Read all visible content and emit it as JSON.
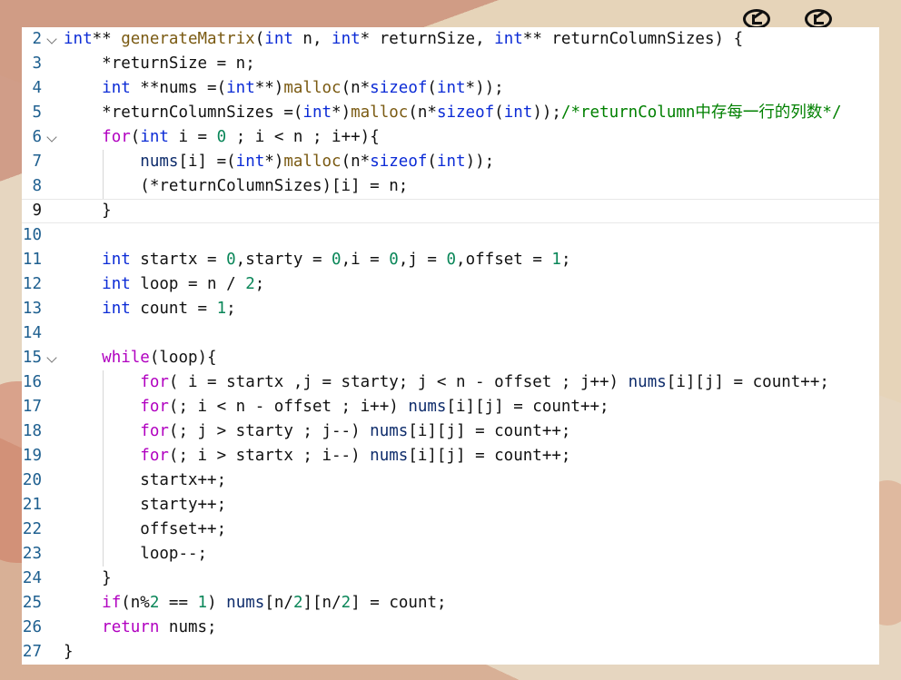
{
  "colors": {
    "editor_bg": "#ffffff",
    "line_number": "#1e5f8f",
    "keyword": "#0b2bd6",
    "control": "#b100c0",
    "function": "#7a5a12",
    "number": "#098658",
    "comment": "#008000"
  },
  "toolbar": {
    "icons": [
      "arrow-back-circle-icon",
      "arrow-back-circle-icon"
    ]
  },
  "editor": {
    "current_line": 9,
    "lines": [
      {
        "n": "2",
        "fold": true,
        "indent": 0,
        "tokens": [
          [
            "ty",
            "int"
          ],
          [
            "p",
            "** "
          ],
          [
            "fn",
            "generateMatrix"
          ],
          [
            "p",
            "("
          ],
          [
            "ty",
            "int"
          ],
          [
            "p",
            " n, "
          ],
          [
            "ty",
            "int"
          ],
          [
            "p",
            "* returnSize, "
          ],
          [
            "ty",
            "int"
          ],
          [
            "p",
            "** returnColumnSizes) {"
          ]
        ]
      },
      {
        "n": "3",
        "fold": false,
        "indent": 1,
        "tokens": [
          [
            "p",
            "*returnSize = n;"
          ]
        ]
      },
      {
        "n": "4",
        "fold": false,
        "indent": 1,
        "tokens": [
          [
            "ty",
            "int"
          ],
          [
            "p",
            " **nums =("
          ],
          [
            "ty",
            "int"
          ],
          [
            "p",
            "**)"
          ],
          [
            "fn",
            "malloc"
          ],
          [
            "p",
            "(n*"
          ],
          [
            "kw",
            "sizeof"
          ],
          [
            "p",
            "("
          ],
          [
            "ty",
            "int"
          ],
          [
            "p",
            "*));"
          ]
        ]
      },
      {
        "n": "5",
        "fold": false,
        "indent": 1,
        "tokens": [
          [
            "p",
            "*returnColumnSizes =("
          ],
          [
            "ty",
            "int"
          ],
          [
            "p",
            "*)"
          ],
          [
            "fn",
            "malloc"
          ],
          [
            "p",
            "(n*"
          ],
          [
            "kw",
            "sizeof"
          ],
          [
            "p",
            "("
          ],
          [
            "ty",
            "int"
          ],
          [
            "p",
            "));"
          ],
          [
            "cm",
            "/*returnColumn中存每一行的列数*/"
          ]
        ]
      },
      {
        "n": "6",
        "fold": true,
        "indent": 1,
        "tokens": [
          [
            "ctrl",
            "for"
          ],
          [
            "p",
            "("
          ],
          [
            "ty",
            "int"
          ],
          [
            "p",
            " i = "
          ],
          [
            "num",
            "0"
          ],
          [
            "p",
            " ; i < n ; i++){"
          ]
        ]
      },
      {
        "n": "7",
        "fold": false,
        "indent": 2,
        "tokens": [
          [
            "var",
            "nums"
          ],
          [
            "p",
            "[i] =("
          ],
          [
            "ty",
            "int"
          ],
          [
            "p",
            "*)"
          ],
          [
            "fn",
            "malloc"
          ],
          [
            "p",
            "(n*"
          ],
          [
            "kw",
            "sizeof"
          ],
          [
            "p",
            "("
          ],
          [
            "ty",
            "int"
          ],
          [
            "p",
            "));"
          ]
        ]
      },
      {
        "n": "8",
        "fold": false,
        "indent": 2,
        "tokens": [
          [
            "p",
            "(*returnColumnSizes)[i] = n;"
          ]
        ]
      },
      {
        "n": "9",
        "fold": false,
        "indent": 1,
        "tokens": [
          [
            "p",
            "}"
          ]
        ]
      },
      {
        "n": "10",
        "fold": false,
        "indent": 0,
        "tokens": []
      },
      {
        "n": "11",
        "fold": false,
        "indent": 1,
        "tokens": [
          [
            "ty",
            "int"
          ],
          [
            "p",
            " startx = "
          ],
          [
            "num",
            "0"
          ],
          [
            "p",
            ",starty = "
          ],
          [
            "num",
            "0"
          ],
          [
            "p",
            ",i = "
          ],
          [
            "num",
            "0"
          ],
          [
            "p",
            ",j = "
          ],
          [
            "num",
            "0"
          ],
          [
            "p",
            ",offset = "
          ],
          [
            "num",
            "1"
          ],
          [
            "p",
            ";"
          ]
        ]
      },
      {
        "n": "12",
        "fold": false,
        "indent": 1,
        "tokens": [
          [
            "ty",
            "int"
          ],
          [
            "p",
            " loop = n / "
          ],
          [
            "num",
            "2"
          ],
          [
            "p",
            ";"
          ]
        ]
      },
      {
        "n": "13",
        "fold": false,
        "indent": 1,
        "tokens": [
          [
            "ty",
            "int"
          ],
          [
            "p",
            " count = "
          ],
          [
            "num",
            "1"
          ],
          [
            "p",
            ";"
          ]
        ]
      },
      {
        "n": "14",
        "fold": false,
        "indent": 0,
        "tokens": []
      },
      {
        "n": "15",
        "fold": true,
        "indent": 1,
        "tokens": [
          [
            "ctrl",
            "while"
          ],
          [
            "p",
            "(loop){"
          ]
        ]
      },
      {
        "n": "16",
        "fold": false,
        "indent": 2,
        "tokens": [
          [
            "ctrl",
            "for"
          ],
          [
            "p",
            "( i = startx ,j = starty; j < n - offset ; j++) "
          ],
          [
            "var",
            "nums"
          ],
          [
            "p",
            "[i][j] = count++;"
          ]
        ]
      },
      {
        "n": "17",
        "fold": false,
        "indent": 2,
        "tokens": [
          [
            "ctrl",
            "for"
          ],
          [
            "p",
            "(; i < n - offset ; i++) "
          ],
          [
            "var",
            "nums"
          ],
          [
            "p",
            "[i][j] = count++;"
          ]
        ]
      },
      {
        "n": "18",
        "fold": false,
        "indent": 2,
        "tokens": [
          [
            "ctrl",
            "for"
          ],
          [
            "p",
            "(; j > starty ; j--) "
          ],
          [
            "var",
            "nums"
          ],
          [
            "p",
            "[i][j] = count++;"
          ]
        ]
      },
      {
        "n": "19",
        "fold": false,
        "indent": 2,
        "tokens": [
          [
            "ctrl",
            "for"
          ],
          [
            "p",
            "(; i > startx ; i--) "
          ],
          [
            "var",
            "nums"
          ],
          [
            "p",
            "[i][j] = count++;"
          ]
        ]
      },
      {
        "n": "20",
        "fold": false,
        "indent": 2,
        "tokens": [
          [
            "p",
            "startx++;"
          ]
        ]
      },
      {
        "n": "21",
        "fold": false,
        "indent": 2,
        "tokens": [
          [
            "p",
            "starty++;"
          ]
        ]
      },
      {
        "n": "22",
        "fold": false,
        "indent": 2,
        "tokens": [
          [
            "p",
            "offset++;"
          ]
        ]
      },
      {
        "n": "23",
        "fold": false,
        "indent": 2,
        "tokens": [
          [
            "p",
            "loop--;"
          ]
        ]
      },
      {
        "n": "24",
        "fold": false,
        "indent": 1,
        "tokens": [
          [
            "p",
            "}"
          ]
        ]
      },
      {
        "n": "25",
        "fold": false,
        "indent": 1,
        "tokens": [
          [
            "ctrl",
            "if"
          ],
          [
            "p",
            "(n%"
          ],
          [
            "num",
            "2"
          ],
          [
            "p",
            " == "
          ],
          [
            "num",
            "1"
          ],
          [
            "p",
            ") "
          ],
          [
            "var",
            "nums"
          ],
          [
            "p",
            "[n/"
          ],
          [
            "num",
            "2"
          ],
          [
            "p",
            "][n/"
          ],
          [
            "num",
            "2"
          ],
          [
            "p",
            "] = count;"
          ]
        ]
      },
      {
        "n": "26",
        "fold": false,
        "indent": 1,
        "tokens": [
          [
            "ctrl",
            "return"
          ],
          [
            "p",
            " nums;"
          ]
        ]
      },
      {
        "n": "27",
        "fold": false,
        "indent": 0,
        "tokens": [
          [
            "p",
            "}"
          ]
        ]
      }
    ]
  }
}
